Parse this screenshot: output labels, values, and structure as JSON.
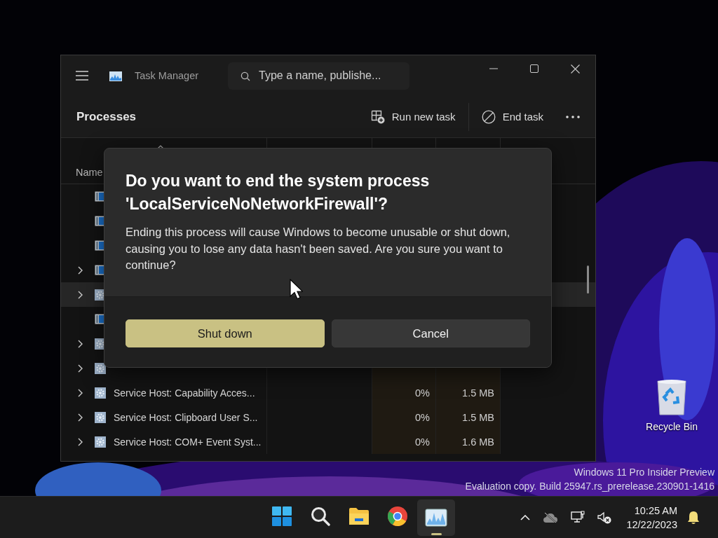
{
  "window": {
    "title": "Task Manager"
  },
  "search": {
    "placeholder": "Type a name, publishe..."
  },
  "page_title": "Processes",
  "commands": [
    {
      "kind": "run",
      "label": "Run new task"
    },
    {
      "kind": "end",
      "label": "End task"
    },
    {
      "kind": "more"
    }
  ],
  "table": {
    "columns": [
      {
        "label": "Name",
        "sorted": true
      }
    ],
    "rows": [
      {
        "kind": "app",
        "expandable": false,
        "selected": false
      },
      {
        "kind": "app",
        "expandable": false,
        "selected": false
      },
      {
        "kind": "app",
        "expandable": false,
        "selected": false
      },
      {
        "kind": "app",
        "expandable": true,
        "selected": false
      },
      {
        "kind": "service",
        "expandable": true,
        "selected": true
      },
      {
        "kind": "app",
        "expandable": false,
        "selected": false
      },
      {
        "kind": "service",
        "expandable": true,
        "selected": false
      },
      {
        "kind": "service",
        "expandable": true,
        "selected": false
      },
      {
        "kind": "service",
        "expandable": true,
        "selected": false,
        "name": "Service Host: Capability Acces...",
        "column_3": "0%",
        "column_4": "1.5 MB"
      },
      {
        "kind": "service",
        "expandable": true,
        "selected": false,
        "name": "Service Host: Clipboard User S...",
        "column_3": "0%",
        "column_4": "1.5 MB"
      },
      {
        "kind": "service",
        "expandable": true,
        "selected": false,
        "name": "Service Host: COM+ Event Syst...",
        "column_3": "0%",
        "column_4": "1.6 MB"
      }
    ]
  },
  "dialog": {
    "title": "Do you want to end the system process 'LocalServiceNoNetworkFirewall'?",
    "message": "Ending this process will cause Windows to become unusable or shut down, causing you to lose any data hasn't been saved. Are you sure you want to continue?",
    "buttons": [
      {
        "label": "Shut down",
        "primary": true
      },
      {
        "label": "Cancel",
        "primary": false
      }
    ]
  },
  "desktop": {
    "icons": [
      {
        "label": "Recycle Bin"
      }
    ],
    "watermark": [
      "Windows 11 Pro Insider Preview",
      "Evaluation copy. Build 25947.rs_prerelease.230901-1416"
    ]
  },
  "taskbar": {
    "apps": [
      {
        "kind": "start",
        "selected": false
      },
      {
        "kind": "search",
        "selected": false
      },
      {
        "kind": "files",
        "selected": false
      },
      {
        "kind": "browser",
        "selected": false
      },
      {
        "kind": "monitor",
        "selected": true
      }
    ],
    "tray": [
      {
        "kind": "chevron"
      },
      {
        "kind": "cloud"
      },
      {
        "kind": "network"
      },
      {
        "kind": "volume"
      }
    ],
    "clock": {
      "time": "10:25 AM",
      "date": "12/22/2023"
    }
  }
}
